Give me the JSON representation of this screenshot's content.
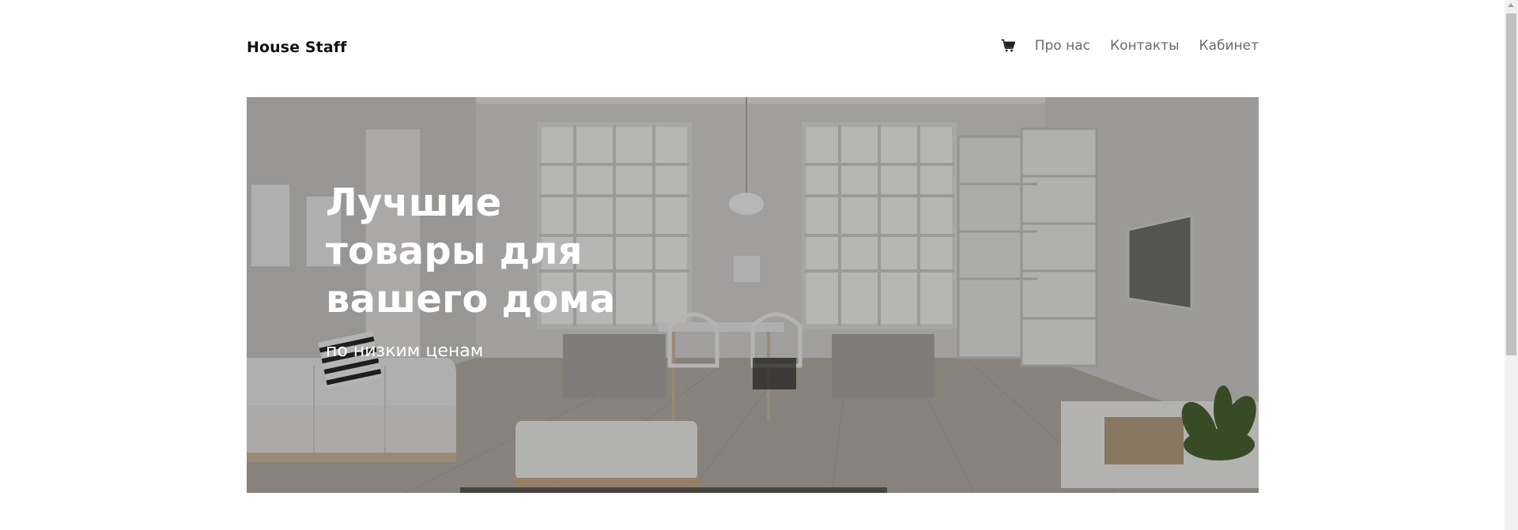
{
  "header": {
    "brand": "House Staff",
    "cart_icon": "cart-icon",
    "nav": [
      {
        "label": "Про нас"
      },
      {
        "label": "Контакты"
      },
      {
        "label": "Кабинет"
      }
    ]
  },
  "hero": {
    "title": "Лучшие товары для вашего дома",
    "subtitle": "по низким ценам",
    "image_description_colors": {
      "walls": "#d9d8d6",
      "floor": "#a89f95",
      "accent_plant": "#3f5a2a"
    }
  },
  "colors": {
    "nav_text": "#6b6b6b",
    "brand_text": "#111111",
    "hero_text": "#ffffff"
  }
}
